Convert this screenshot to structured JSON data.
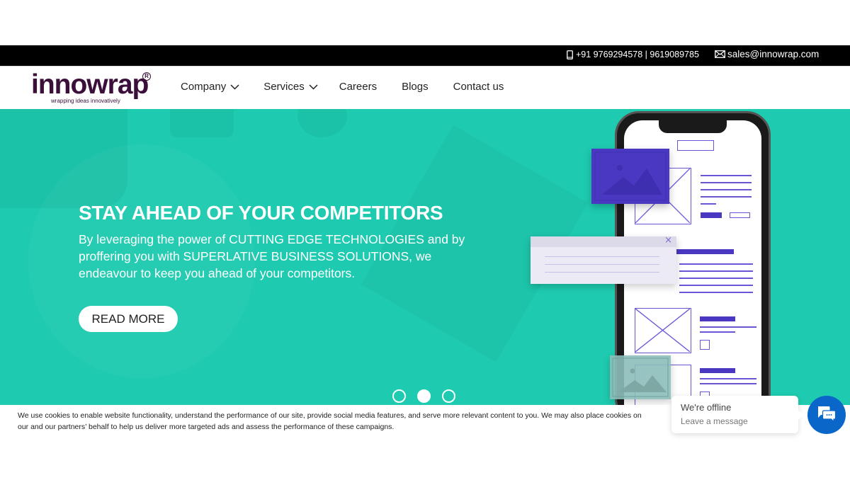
{
  "topbar": {
    "phone": "+91 9769294578 | 9619089785",
    "email": "sales@innowrap.com",
    "phone_icon": "mobile-phone-icon",
    "email_icon": "envelope-icon"
  },
  "header": {
    "logo": {
      "wordmark": "innowrap",
      "registered": "R",
      "tagline": "wrapping ideas innovatively"
    },
    "nav": [
      {
        "label": "Company",
        "has_dropdown": true
      },
      {
        "label": "Services",
        "has_dropdown": true
      },
      {
        "label": "Careers",
        "has_dropdown": false
      },
      {
        "label": "Blogs",
        "has_dropdown": false
      },
      {
        "label": "Contact us",
        "has_dropdown": false
      }
    ]
  },
  "hero": {
    "title": "STAY AHEAD OF YOUR COMPETITORS",
    "subtitle": "By leveraging the power of CUTTING EDGE TECHNOLOGIES and by proffering you with SUPERLATIVE BUSINESS SOLUTIONS, we endeavour to keep you ahead of your competitors.",
    "cta_label": "READ MORE",
    "background_color": "#1ecbb0",
    "slides": {
      "count": 3,
      "active_index": 1
    },
    "popup_close": "×"
  },
  "cookie": {
    "text_line1": "We use cookies to enable website functionality, understand the performance of our site, provide social media features, and serve more relevant content to you. We may also place cookies on",
    "text_line2": "our and our partners’ behalf to help us deliver more targeted ads and assess the performance of these campaigns."
  },
  "chat": {
    "status": "We're offline",
    "action": "Leave a message",
    "button_color": "#0a66c8",
    "icon": "chat-bubbles-icon"
  }
}
